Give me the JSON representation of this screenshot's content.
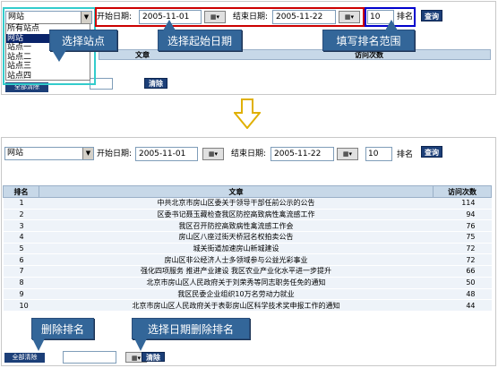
{
  "top": {
    "site_select": "网站",
    "site_options": [
      "所有站点",
      "网站",
      "站点一",
      "站点二",
      "站点三",
      "站点四"
    ],
    "start_label": "开始日期:",
    "start_date": "2005-11-01",
    "end_label": "结束日期:",
    "end_date": "2005-11-22",
    "rank_value": "10",
    "rank_label": "排名",
    "query_button": "查询",
    "header_article": "文章",
    "header_visits": "访问次数",
    "clear_button": "清除",
    "clear_all_button": "全部清除"
  },
  "callouts": {
    "select_site": "选择站点",
    "select_start": "选择起始日期",
    "fill_rank": "填写排名范围",
    "delete_rank": "删除排名",
    "delete_by_date": "选择日期删除排名"
  },
  "bottom": {
    "site_select": "网站",
    "start_label": "开始日期:",
    "start_date": "2005-11-01",
    "end_label": "结束日期:",
    "end_date": "2005-11-22",
    "rank_value": "10",
    "rank_label": "排名",
    "query_button": "查询",
    "clear_all_button": "全部清除",
    "clear_button": "清除",
    "table": {
      "headers": [
        "排名",
        "文章",
        "访问次数"
      ],
      "rows": [
        [
          "1",
          "中共北京市房山区委关于领导干部任前公示的公告",
          "114"
        ],
        [
          "2",
          "区委书记聂玉藏检查我区防控高致病性禽流感工作",
          "94"
        ],
        [
          "3",
          "我区召开防控高致病性禽流感工作会",
          "76"
        ],
        [
          "4",
          "房山区八座过街天桥冠名权拍卖公告",
          "75"
        ],
        [
          "5",
          "城关街道加速房山新城建设",
          "72"
        ],
        [
          "6",
          "房山区非公经济人士多领域参与公益光彩事业",
          "72"
        ],
        [
          "7",
          "强化四项服务  推进产业建设   我区农业产业化水平进一步提升",
          "66"
        ],
        [
          "8",
          "北京市房山区人民政府关于刘荣秀等同志职务任免的通知",
          "50"
        ],
        [
          "9",
          "我区民委企业组织10万名劳动力就业",
          "48"
        ],
        [
          "10",
          "北京市房山区人民政府关于表彰房山区科学技术奖申报工作的通知",
          "44"
        ]
      ]
    }
  },
  "icons": {
    "calendar": "calendar-icon",
    "arrow_down": "arrow-down-icon"
  },
  "colors": {
    "highlight_cyan": "#33cccc",
    "highlight_red": "#cc0000",
    "highlight_blue": "#0000cc",
    "callout_bg": "#336699",
    "button_bg": "#1c3f78",
    "table_header": "#c7d8e8",
    "table_row": "#eef3f9"
  }
}
